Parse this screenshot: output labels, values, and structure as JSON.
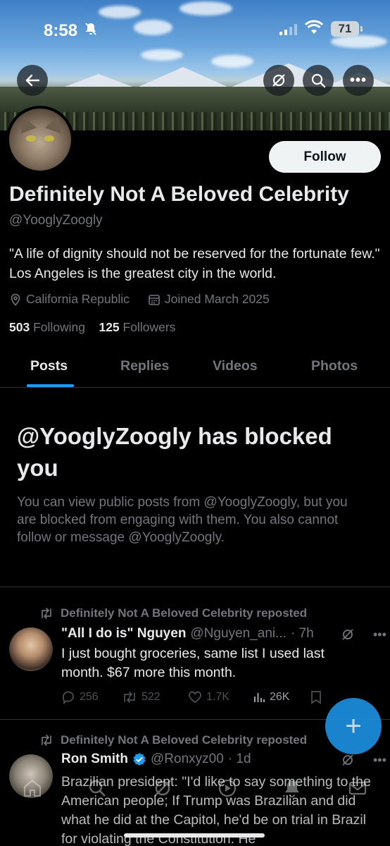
{
  "status_bar": {
    "time": "8:58",
    "battery": "71"
  },
  "profile": {
    "name": "Definitely Not A Beloved Celebrity",
    "handle": "@YooglyZoogly",
    "bio": "\"A life of dignity should not be reserved for the fortunate few.\" Los Angeles is the greatest city in the world.",
    "location": "California Republic",
    "joined": "Joined March 2025",
    "following_count": "503",
    "following_label": "Following",
    "followers_count": "125",
    "followers_label": "Followers",
    "follow_button": "Follow"
  },
  "tabs": [
    {
      "label": "Posts",
      "active": true
    },
    {
      "label": "Replies",
      "active": false
    },
    {
      "label": "Videos",
      "active": false
    },
    {
      "label": "Photos",
      "active": false
    }
  ],
  "blocked": {
    "title": "@YooglyZoogly has blocked you",
    "text": "You can view public posts from @YooglyZoogly, but you are blocked from engaging with them. You also cannot follow or message @YooglyZoogly."
  },
  "posts": [
    {
      "repost_label": "Definitely Not A Beloved Celebrity reposted",
      "author": "\"All I do is\" Nguyen",
      "handle": "@Nguyen_ani...",
      "time": "· 7h",
      "text": "I just bought groceries, same list I used last month. $67 more this month.",
      "replies": "256",
      "reposts": "522",
      "likes": "1.7K",
      "views": "26K"
    },
    {
      "repost_label": "Definitely Not A Beloved Celebrity reposted",
      "author": "Ron Smith",
      "handle": "@Ronxyz00",
      "time": "· 1d",
      "text": "Brazilian president: \"I'd like to say something to the American people; If Trump was Brazilian and did what he did at the Capitol, he'd be on trial in Brazil for violating the Constitution. He"
    }
  ],
  "colors": {
    "accent": "#1d9bf0",
    "background": "#000000",
    "muted": "#71767b"
  }
}
